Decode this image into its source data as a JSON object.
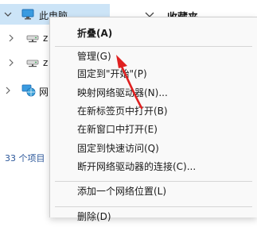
{
  "nav": {
    "items": [
      {
        "label": "此电脑",
        "icon": "computer-icon"
      },
      {
        "label": "z",
        "icon": "network-drive-icon"
      },
      {
        "label": "z",
        "icon": "network-drive-icon"
      },
      {
        "label": "网",
        "icon": "network-icon"
      }
    ]
  },
  "status": {
    "count": "33 个项目"
  },
  "right": {
    "title": "收藏夹"
  },
  "menu": {
    "items": [
      {
        "label": "折叠(A)",
        "bold": true
      },
      {
        "label": "管理(G)"
      },
      {
        "label": "固定到\"开始\"(P)"
      },
      {
        "label": "映射网络驱动器(N)..."
      },
      {
        "label": "在新标签页中打开(B)"
      },
      {
        "label": "在新窗口中打开(E)"
      },
      {
        "label": "固定到快速访问(Q)"
      },
      {
        "label": "断开网络驱动器的连接(C)..."
      },
      {
        "label": "添加一个网络位置(L)"
      },
      {
        "label": "删除(D)"
      }
    ]
  },
  "colors": {
    "selection": "#cce4f7",
    "arrow": "#e02020",
    "status_text": "#2b579a"
  }
}
